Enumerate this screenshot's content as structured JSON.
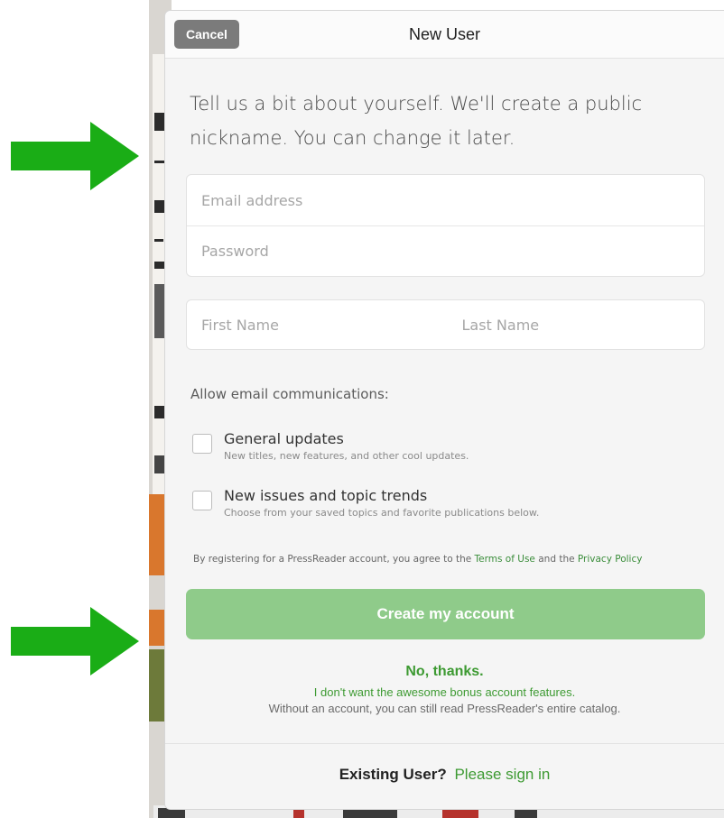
{
  "header": {
    "cancel_label": "Cancel",
    "title": "New User"
  },
  "intro": {
    "line1": "Tell us a bit about yourself. We'll create a public",
    "line2": "nickname. You can change it later."
  },
  "form": {
    "email_placeholder": "Email address",
    "password_placeholder": "Password",
    "first_name_placeholder": "First Name",
    "last_name_placeholder": "Last Name"
  },
  "communications": {
    "label": "Allow email communications:",
    "options": [
      {
        "title": "General updates",
        "subtitle": "New titles, new features, and other cool updates.",
        "checked": false
      },
      {
        "title": "New issues and topic trends",
        "subtitle": "Choose from your saved topics and favorite publications below.",
        "checked": false
      }
    ]
  },
  "terms": {
    "prefix": "By registering for a PressReader account, you agree to the",
    "terms_link": "Terms of Use",
    "middle": "and the",
    "privacy_link": "Privacy Policy"
  },
  "create_button_label": "Create my account",
  "no_thanks": {
    "title": "No, thanks.",
    "subtitle": "I don't want the awesome bonus account features.",
    "note": "Without an account, you can still read PressReader's entire catalog."
  },
  "footer": {
    "existing_label": "Existing User?",
    "signin_link": "Please sign in"
  },
  "colors": {
    "accent_green": "#3d9a32",
    "button_green": "#8fcb8a",
    "annotation_arrow": "#1aad16",
    "cancel_gray": "#7b7b7b"
  },
  "annotations": [
    "arrow-right-icon",
    "arrow-right-icon"
  ]
}
